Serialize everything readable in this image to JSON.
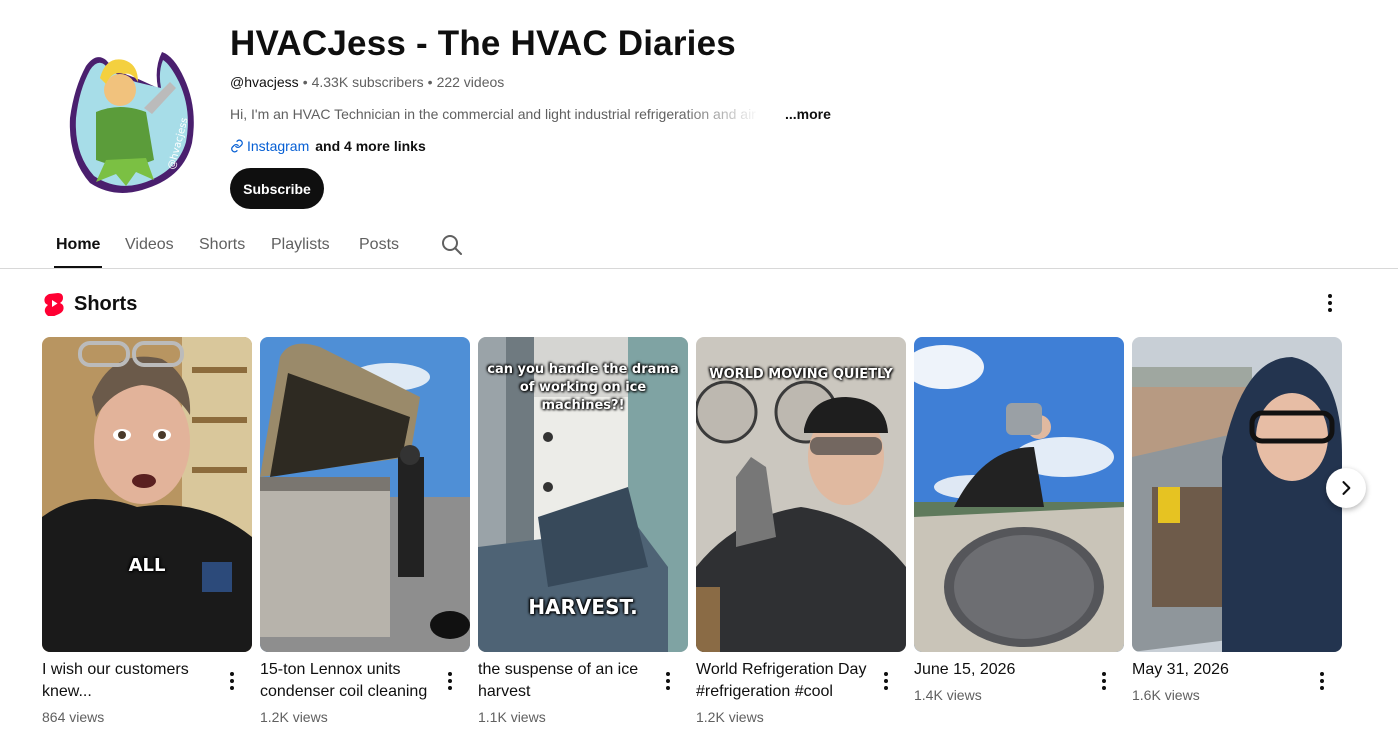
{
  "channel": {
    "title": "HVACJess - The HVAC Diaries",
    "handle": "@hvacjess",
    "subscribers": "4.33K subscribers",
    "videos": "222 videos",
    "separator": "•",
    "description": "Hi, I'm an HVAC Technician in the commercial and light industrial refrigeration and air conditioning field.",
    "more_label": "...more",
    "link_label": "Instagram",
    "more_links": "and 4 more links",
    "subscribe_label": "Subscribe",
    "avatar_caption": "@hvacjess"
  },
  "tabs": [
    {
      "label": "Home",
      "active": true
    },
    {
      "label": "Videos"
    },
    {
      "label": "Shorts"
    },
    {
      "label": "Playlists"
    },
    {
      "label": "Posts"
    }
  ],
  "shorts": {
    "section_title": "Shorts",
    "items": [
      {
        "title": "I wish our customers knew...",
        "views": "864 views",
        "overlay": "ALL"
      },
      {
        "title": "15-ton Lennox units condenser coil cleaning",
        "views": "1.2K views",
        "overlay": ""
      },
      {
        "title": "the suspense of an ice harvest",
        "views": "1.1K views",
        "overlay": "can you handle the drama of working on ice machines?!",
        "overlay2": "HARVEST."
      },
      {
        "title": "World Refrigeration Day #refrigeration #cool",
        "views": "1.2K views",
        "overlay": "WORLD MOVING QUIETLY"
      },
      {
        "title": "June 15, 2026",
        "views": "1.4K views",
        "overlay": ""
      },
      {
        "title": "May 31, 2026",
        "views": "1.6K views",
        "overlay": ""
      }
    ]
  },
  "icons": {
    "shorts_logo": "youtube-shorts-icon",
    "search": "search-icon",
    "menu": "vertical-dots-icon",
    "link": "link-icon",
    "next": "chevron-right-icon"
  },
  "colors": {
    "accent": "#0f0f0f",
    "link": "#065fd4",
    "shorts_red": "#ff0033",
    "secondary_text": "#606060"
  }
}
